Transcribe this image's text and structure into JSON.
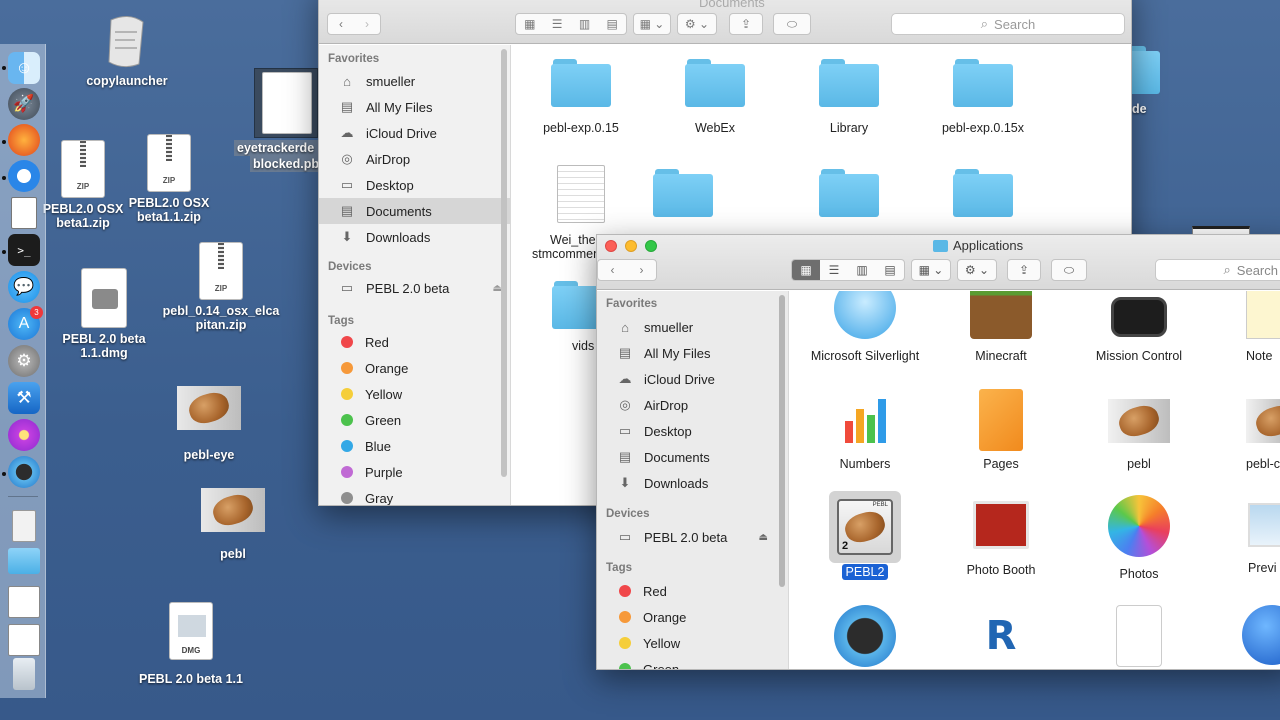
{
  "desktop": {
    "items": [
      {
        "label": "copylauncher"
      },
      {
        "label": "eyetrackerdemo blocked.pbl",
        "line1": "eyetrackerde",
        "line2": "blocked.pb"
      },
      {
        "label": "PEBL2.0 OSX beta1.zip",
        "line1": "PEBL2.0 OSX",
        "line2": "beta1.zip"
      },
      {
        "label": "PEBL2.0 OSX beta1.1.zip",
        "line1": "PEBL2.0 OSX",
        "line2": "beta1.1.zip"
      },
      {
        "label": "PEBL 2.0 beta 1.1.dmg",
        "line1": "PEBL 2.0 beta",
        "line2": "1.1.dmg"
      },
      {
        "label": "pebl_0.14_osx_elcapitan.zip",
        "line1": "pebl_0.14_osx_elca",
        "line2": "pitan.zip"
      },
      {
        "label": "pebl-eye"
      },
      {
        "label": "pebl"
      },
      {
        "label": "PEBL 2.0 beta 1.1"
      },
      {
        "label": "de"
      }
    ]
  },
  "dock": {
    "badge": "3",
    "items": [
      "finder-icon",
      "launchpad-icon",
      "firefox-icon",
      "safari-icon",
      "document-icon",
      "terminal-icon",
      "messages-icon",
      "appstore-icon",
      "system-preferences-icon",
      "xcode-icon",
      "flower-icon",
      "quicktime-icon",
      "archive-icon",
      "folder-icon",
      "stack-icon",
      "stack-icon",
      "stack-icon",
      "trash-icon"
    ]
  },
  "back_window": {
    "title": "Documents",
    "search_placeholder": "Search",
    "sidebar": {
      "favorites_header": "Favorites",
      "favorites": [
        "smueller",
        "All My Files",
        "iCloud Drive",
        "AirDrop",
        "Desktop",
        "Documents",
        "Downloads"
      ],
      "selected": "Documents",
      "devices_header": "Devices",
      "devices": [
        "PEBL 2.0 beta"
      ],
      "tags_header": "Tags",
      "tags": [
        {
          "name": "Red",
          "color": "#f0474a"
        },
        {
          "name": "Orange",
          "color": "#f6993a"
        },
        {
          "name": "Yellow",
          "color": "#f5ce3a"
        },
        {
          "name": "Green",
          "color": "#4cc24d"
        },
        {
          "name": "Blue",
          "color": "#33a8e6"
        },
        {
          "name": "Purple",
          "color": "#c06ad4"
        },
        {
          "name": "Gray",
          "color": "#8f8f8f"
        }
      ]
    },
    "files": [
      {
        "name": "pebl-exp.0.15"
      },
      {
        "name": "WebEx"
      },
      {
        "name": "Library"
      },
      {
        "name": "pebl-exp.0.15x"
      },
      {
        "name": "Wei_thesis stmcomments",
        "line1": "Wei_thes",
        "line2": "stmcommen"
      },
      {
        "name": ""
      },
      {
        "name": ""
      },
      {
        "name": ""
      },
      {
        "name": "vids"
      }
    ]
  },
  "front_window": {
    "title": "Applications",
    "search_placeholder": "Search",
    "sidebar": {
      "favorites_header": "Favorites",
      "favorites": [
        "smueller",
        "All My Files",
        "iCloud Drive",
        "AirDrop",
        "Desktop",
        "Documents",
        "Downloads"
      ],
      "devices_header": "Devices",
      "devices": [
        "PEBL 2.0 beta"
      ],
      "tags_header": "Tags",
      "tags": [
        {
          "name": "Red",
          "color": "#f0474a"
        },
        {
          "name": "Orange",
          "color": "#f6993a"
        },
        {
          "name": "Yellow",
          "color": "#f5ce3a"
        },
        {
          "name": "Green",
          "color": "#4cc24d"
        }
      ]
    },
    "apps": [
      {
        "name": "Microsoft Silverlight"
      },
      {
        "name": "Minecraft"
      },
      {
        "name": "Mission Control"
      },
      {
        "name": "Note"
      },
      {
        "name": "Numbers"
      },
      {
        "name": "Pages"
      },
      {
        "name": "pebl"
      },
      {
        "name": "pebl-c"
      },
      {
        "name": "PEBL2",
        "selected": true,
        "badge": "2",
        "label_top": "PEBL"
      },
      {
        "name": "Photo Booth"
      },
      {
        "name": "Photos"
      },
      {
        "name": "Previ"
      },
      {
        "name": ""
      },
      {
        "name": ""
      },
      {
        "name": ""
      },
      {
        "name": ""
      }
    ]
  }
}
